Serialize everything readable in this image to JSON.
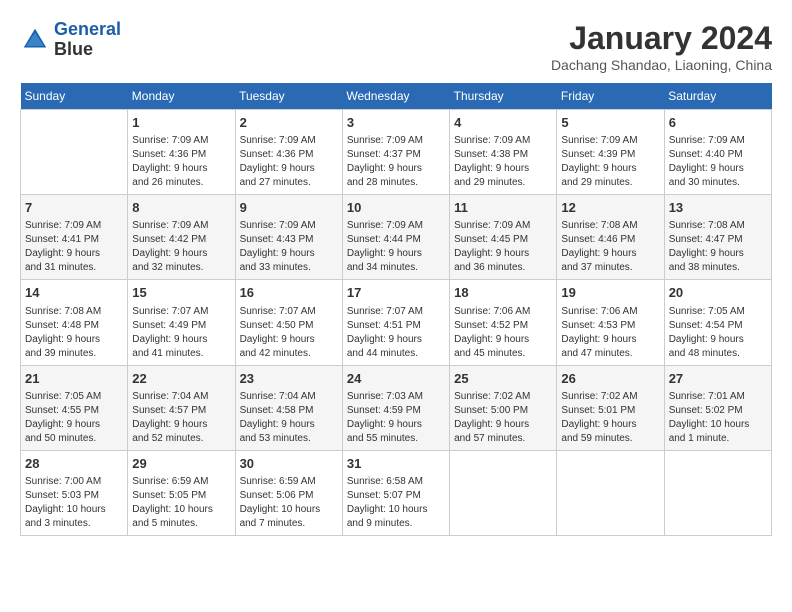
{
  "header": {
    "logo_line1": "General",
    "logo_line2": "Blue",
    "month": "January 2024",
    "location": "Dachang Shandao, Liaoning, China"
  },
  "weekdays": [
    "Sunday",
    "Monday",
    "Tuesday",
    "Wednesday",
    "Thursday",
    "Friday",
    "Saturday"
  ],
  "weeks": [
    [
      {
        "day": "",
        "info": ""
      },
      {
        "day": "1",
        "info": "Sunrise: 7:09 AM\nSunset: 4:36 PM\nDaylight: 9 hours\nand 26 minutes."
      },
      {
        "day": "2",
        "info": "Sunrise: 7:09 AM\nSunset: 4:36 PM\nDaylight: 9 hours\nand 27 minutes."
      },
      {
        "day": "3",
        "info": "Sunrise: 7:09 AM\nSunset: 4:37 PM\nDaylight: 9 hours\nand 28 minutes."
      },
      {
        "day": "4",
        "info": "Sunrise: 7:09 AM\nSunset: 4:38 PM\nDaylight: 9 hours\nand 29 minutes."
      },
      {
        "day": "5",
        "info": "Sunrise: 7:09 AM\nSunset: 4:39 PM\nDaylight: 9 hours\nand 29 minutes."
      },
      {
        "day": "6",
        "info": "Sunrise: 7:09 AM\nSunset: 4:40 PM\nDaylight: 9 hours\nand 30 minutes."
      }
    ],
    [
      {
        "day": "7",
        "info": "Sunrise: 7:09 AM\nSunset: 4:41 PM\nDaylight: 9 hours\nand 31 minutes."
      },
      {
        "day": "8",
        "info": "Sunrise: 7:09 AM\nSunset: 4:42 PM\nDaylight: 9 hours\nand 32 minutes."
      },
      {
        "day": "9",
        "info": "Sunrise: 7:09 AM\nSunset: 4:43 PM\nDaylight: 9 hours\nand 33 minutes."
      },
      {
        "day": "10",
        "info": "Sunrise: 7:09 AM\nSunset: 4:44 PM\nDaylight: 9 hours\nand 34 minutes."
      },
      {
        "day": "11",
        "info": "Sunrise: 7:09 AM\nSunset: 4:45 PM\nDaylight: 9 hours\nand 36 minutes."
      },
      {
        "day": "12",
        "info": "Sunrise: 7:08 AM\nSunset: 4:46 PM\nDaylight: 9 hours\nand 37 minutes."
      },
      {
        "day": "13",
        "info": "Sunrise: 7:08 AM\nSunset: 4:47 PM\nDaylight: 9 hours\nand 38 minutes."
      }
    ],
    [
      {
        "day": "14",
        "info": "Sunrise: 7:08 AM\nSunset: 4:48 PM\nDaylight: 9 hours\nand 39 minutes."
      },
      {
        "day": "15",
        "info": "Sunrise: 7:07 AM\nSunset: 4:49 PM\nDaylight: 9 hours\nand 41 minutes."
      },
      {
        "day": "16",
        "info": "Sunrise: 7:07 AM\nSunset: 4:50 PM\nDaylight: 9 hours\nand 42 minutes."
      },
      {
        "day": "17",
        "info": "Sunrise: 7:07 AM\nSunset: 4:51 PM\nDaylight: 9 hours\nand 44 minutes."
      },
      {
        "day": "18",
        "info": "Sunrise: 7:06 AM\nSunset: 4:52 PM\nDaylight: 9 hours\nand 45 minutes."
      },
      {
        "day": "19",
        "info": "Sunrise: 7:06 AM\nSunset: 4:53 PM\nDaylight: 9 hours\nand 47 minutes."
      },
      {
        "day": "20",
        "info": "Sunrise: 7:05 AM\nSunset: 4:54 PM\nDaylight: 9 hours\nand 48 minutes."
      }
    ],
    [
      {
        "day": "21",
        "info": "Sunrise: 7:05 AM\nSunset: 4:55 PM\nDaylight: 9 hours\nand 50 minutes."
      },
      {
        "day": "22",
        "info": "Sunrise: 7:04 AM\nSunset: 4:57 PM\nDaylight: 9 hours\nand 52 minutes."
      },
      {
        "day": "23",
        "info": "Sunrise: 7:04 AM\nSunset: 4:58 PM\nDaylight: 9 hours\nand 53 minutes."
      },
      {
        "day": "24",
        "info": "Sunrise: 7:03 AM\nSunset: 4:59 PM\nDaylight: 9 hours\nand 55 minutes."
      },
      {
        "day": "25",
        "info": "Sunrise: 7:02 AM\nSunset: 5:00 PM\nDaylight: 9 hours\nand 57 minutes."
      },
      {
        "day": "26",
        "info": "Sunrise: 7:02 AM\nSunset: 5:01 PM\nDaylight: 9 hours\nand 59 minutes."
      },
      {
        "day": "27",
        "info": "Sunrise: 7:01 AM\nSunset: 5:02 PM\nDaylight: 10 hours\nand 1 minute."
      }
    ],
    [
      {
        "day": "28",
        "info": "Sunrise: 7:00 AM\nSunset: 5:03 PM\nDaylight: 10 hours\nand 3 minutes."
      },
      {
        "day": "29",
        "info": "Sunrise: 6:59 AM\nSunset: 5:05 PM\nDaylight: 10 hours\nand 5 minutes."
      },
      {
        "day": "30",
        "info": "Sunrise: 6:59 AM\nSunset: 5:06 PM\nDaylight: 10 hours\nand 7 minutes."
      },
      {
        "day": "31",
        "info": "Sunrise: 6:58 AM\nSunset: 5:07 PM\nDaylight: 10 hours\nand 9 minutes."
      },
      {
        "day": "",
        "info": ""
      },
      {
        "day": "",
        "info": ""
      },
      {
        "day": "",
        "info": ""
      }
    ]
  ]
}
